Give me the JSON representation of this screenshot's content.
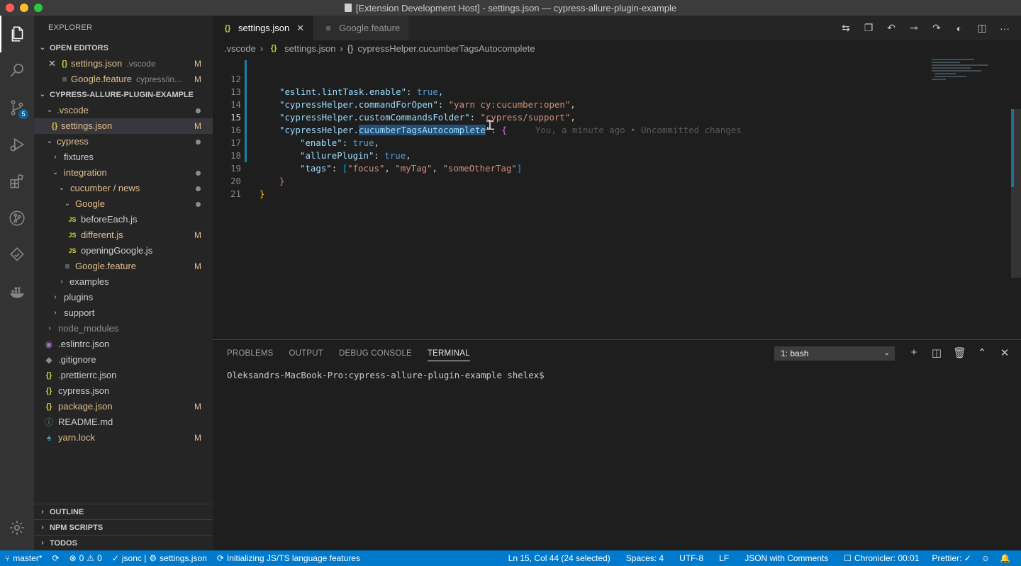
{
  "window": {
    "title": "[Extension Development Host] - settings.json — cypress-allure-plugin-example"
  },
  "activity": {
    "scm_badge": "5"
  },
  "sidebar": {
    "title": "EXPLORER",
    "open_editors_label": "OPEN EDITORS",
    "open_editors": [
      {
        "name": "settings.json",
        "detail": ".vscode",
        "status": "M"
      },
      {
        "name": "Google.feature",
        "detail": "cypress/in...",
        "status": "M"
      }
    ],
    "project_label": "CYPRESS-ALLURE-PLUGIN-EXAMPLE",
    "tree": [
      {
        "name": ".vscode",
        "status": "dot"
      },
      {
        "name": "settings.json",
        "status": "M"
      },
      {
        "name": "cypress",
        "status": "dot"
      },
      {
        "name": "fixtures",
        "status": ""
      },
      {
        "name": "integration",
        "status": "dot"
      },
      {
        "name": "cucumber / news",
        "status": "dot"
      },
      {
        "name": "Google",
        "status": "dot"
      },
      {
        "name": "beforeEach.js",
        "status": ""
      },
      {
        "name": "different.js",
        "status": "M"
      },
      {
        "name": "openingGoogle.js",
        "status": ""
      },
      {
        "name": "Google.feature",
        "status": "M"
      },
      {
        "name": "examples",
        "status": ""
      },
      {
        "name": "plugins",
        "status": ""
      },
      {
        "name": "support",
        "status": ""
      },
      {
        "name": "node_modules",
        "status": ""
      },
      {
        "name": ".eslintrc.json",
        "status": ""
      },
      {
        "name": ".gitignore",
        "status": ""
      },
      {
        "name": ".prettierrc.json",
        "status": ""
      },
      {
        "name": "cypress.json",
        "status": ""
      },
      {
        "name": "package.json",
        "status": "M"
      },
      {
        "name": "README.md",
        "status": ""
      },
      {
        "name": "yarn.lock",
        "status": "M"
      }
    ],
    "bottom_sections": [
      "OUTLINE",
      "NPM SCRIPTS",
      "TODOS"
    ]
  },
  "tabs": [
    {
      "label": "settings.json",
      "active": true
    },
    {
      "label": "Google.feature",
      "active": false
    }
  ],
  "breadcrumbs": [
    ".vscode",
    "settings.json",
    "cypressHelper.cucumberTagsAutocomplete"
  ],
  "editor": {
    "lines": [
      {
        "n": "12",
        "key": "\"eslint.lintTask.enable\"",
        "val": "true"
      },
      {
        "n": "13",
        "key": "\"cypressHelper.commandForOpen\"",
        "val": "\"yarn cy:cucumber:open\""
      },
      {
        "n": "14",
        "key": "\"cypressHelper.customCommandsFolder\"",
        "val": "\"cypress/support\""
      },
      {
        "n": "15",
        "key_pre": "\"cypressHelper.",
        "key_sel": "cucumberTagsAutocomplete",
        "key_post": "\""
      },
      {
        "n": "16",
        "key": "\"enable\"",
        "val": "true"
      },
      {
        "n": "17",
        "key": "\"allurePlugin\"",
        "val": "true"
      },
      {
        "n": "18",
        "key": "\"tags\"",
        "tags": [
          "\"focus\"",
          "\"myTag\"",
          "\"someOtherTag\""
        ]
      },
      {
        "n": "19"
      },
      {
        "n": "20"
      },
      {
        "n": "21"
      }
    ],
    "blame": "You, a minute ago • Uncommitted changes"
  },
  "panel": {
    "tabs": [
      "PROBLEMS",
      "OUTPUT",
      "DEBUG CONSOLE",
      "TERMINAL"
    ],
    "terminal_select": "1: bash",
    "prompt": "Oleksandrs-MacBook-Pro:cypress-allure-plugin-example shelex$"
  },
  "statusbar": {
    "branch": "master*",
    "errors": "0",
    "warnings": "0",
    "lang_check": "jsonc |",
    "file": "settings.json",
    "initializing": "Initializing JS/TS language features",
    "position": "Ln 15, Col 44 (24 selected)",
    "spaces": "Spaces: 4",
    "encoding": "UTF-8",
    "eol": "LF",
    "language": "JSON with Comments",
    "chronicler": "Chronicler: 00:01",
    "prettier": "Prettier: ✓"
  },
  "colors": {
    "accent": "#007acc",
    "modified": "#e2c08d"
  }
}
